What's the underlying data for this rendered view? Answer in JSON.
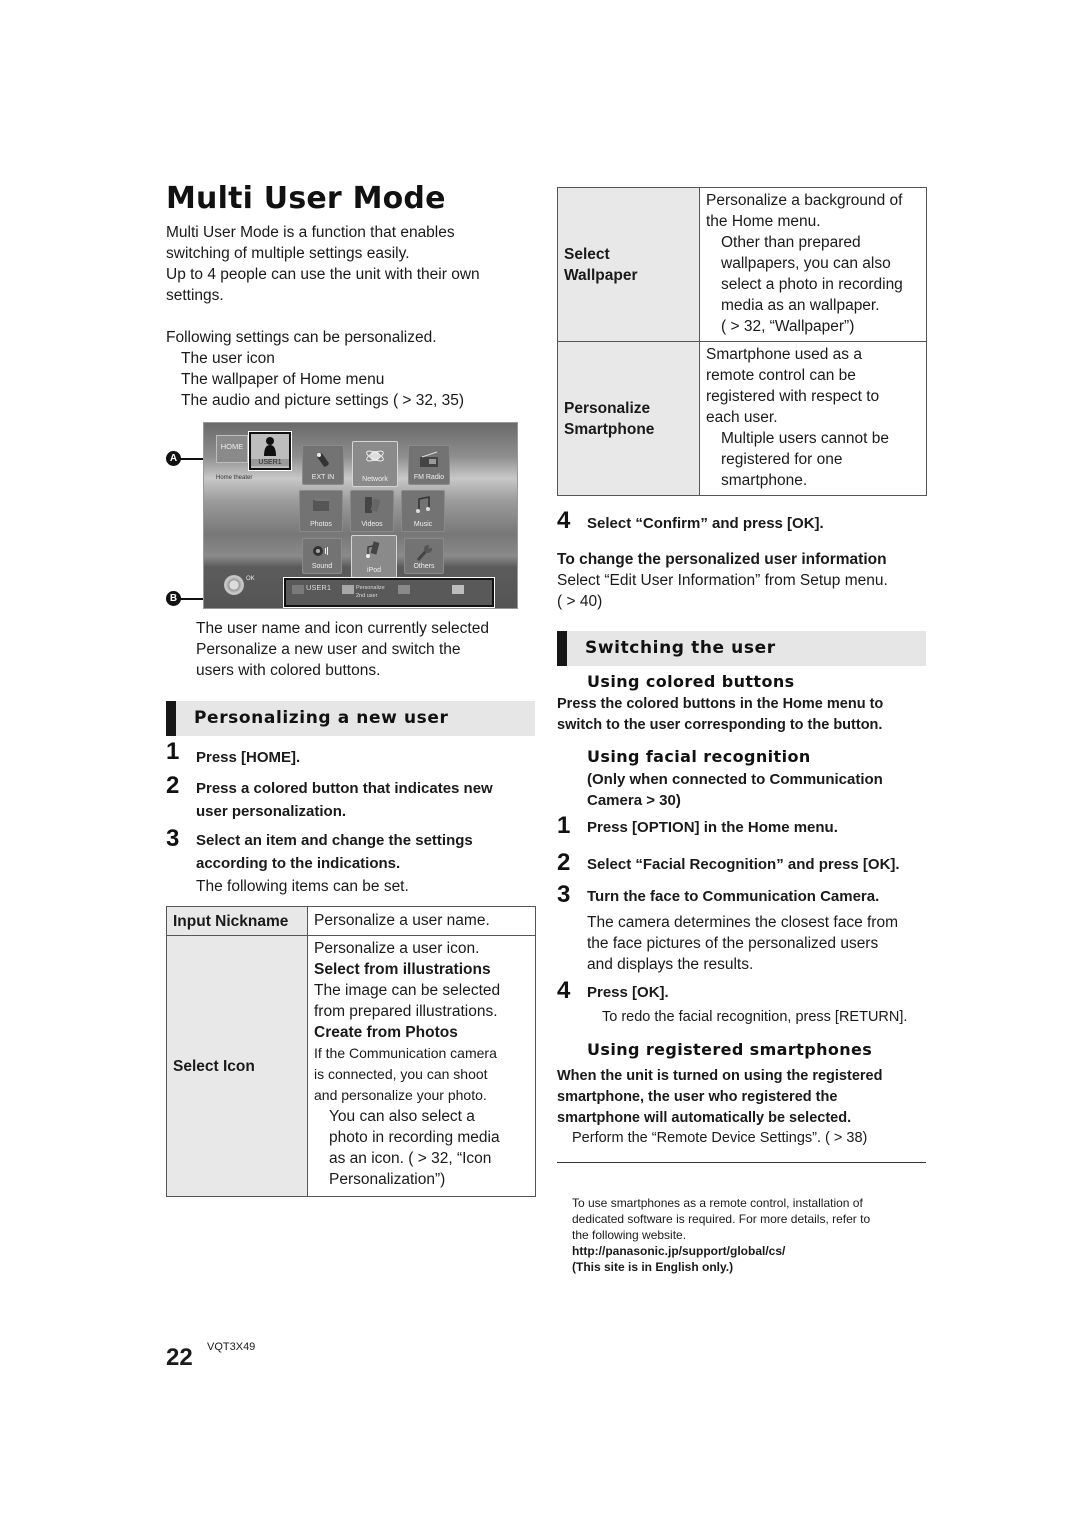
{
  "page": {
    "title": "Multi User Mode",
    "page_number": "22",
    "doc_code": "VQT3X49"
  },
  "intro": {
    "p1_line1": "Multi User Mode is a function that enables",
    "p1_line2": "switching of multiple settings easily.",
    "p2_line1": "Up to 4 people can use the unit with their own",
    "p2_line2": "settings.",
    "list_lead": "Following settings can be personalized.",
    "list_items": [
      "The user icon",
      "The wallpaper of Home menu",
      "The audio and picture settings ( > 32, 35)"
    ]
  },
  "screenshot": {
    "home_label": "HOME",
    "user_label": "USER1",
    "device_label": "Home theater",
    "tiles": [
      {
        "label": "EXT IN",
        "icon": "plug-icon"
      },
      {
        "label": "Network",
        "icon": "globe-icon"
      },
      {
        "label": "FM Radio",
        "icon": "radio-icon"
      },
      {
        "label": "Photos",
        "icon": "photos-icon"
      },
      {
        "label": "Videos",
        "icon": "film-icon"
      },
      {
        "label": "Music",
        "icon": "music-note-icon"
      },
      {
        "label": "Sound",
        "icon": "speaker-icon"
      },
      {
        "label": "iPod",
        "icon": "ipod-icon"
      },
      {
        "label": "Others",
        "icon": "wrench-icon"
      }
    ],
    "ok_label": "OK",
    "bottom_bar": {
      "user": "USER1",
      "personalize_line1": "Personalize",
      "personalize_line2": "2nd user"
    },
    "callouts": [
      "A",
      "B"
    ]
  },
  "callout_desc": {
    "a": "The user name and icon currently selected",
    "b_line1": "Personalize a new user and switch the",
    "b_line2": "users with colored buttons."
  },
  "personalizing": {
    "heading": "Personalizing a new user",
    "steps": [
      {
        "num": "1",
        "line1": "Press [HOME].",
        "line2": ""
      },
      {
        "num": "2",
        "line1": "Press a colored button that indicates new",
        "line2": "user personalization."
      },
      {
        "num": "3",
        "line1": "Select an item and change the settings",
        "line2": "according to the indications."
      }
    ],
    "step3_note": "The following items can be set.",
    "table": [
      {
        "head": "Input Nickname",
        "body": [
          "Personalize a user name."
        ]
      },
      {
        "head": "Select Icon",
        "body": [
          "Personalize a user icon.",
          "Select from illustrations",
          "The image can be selected",
          "from prepared illustrations.",
          "Create from Photos",
          "If the Communication camera",
          "is connected, you can shoot",
          "and personalize your photo.",
          "You can also select a",
          "photo in recording media",
          "as an icon. ( > 32, “Icon",
          "Personalization”)"
        ]
      }
    ]
  },
  "right_table": [
    {
      "head_line1": "Select",
      "head_line2": "Wallpaper",
      "body": [
        "Personalize a background of",
        "the Home menu.",
        "Other than prepared",
        "wallpapers, you can also",
        "select a photo in recording",
        "media as an wallpaper.",
        "( > 32, “Wallpaper”)"
      ]
    },
    {
      "head_line1": "Personalize",
      "head_line2": "Smartphone",
      "body": [
        "Smartphone used as a",
        "remote control can be",
        "registered with respect to",
        "each user.",
        "Multiple users cannot be",
        "registered for one",
        "smartphone."
      ]
    }
  ],
  "step4": {
    "num": "4",
    "text": "Select “Confirm” and press [OK]."
  },
  "change_info": {
    "heading": "To change the personalized user information",
    "line1": "Select “Edit User Information” from Setup menu.",
    "line2": "( > 40)"
  },
  "switching": {
    "heading": "Switching the user",
    "colored": {
      "heading": "Using colored buttons",
      "line1": "Press the colored buttons in the Home menu to",
      "line2": "switch to the user corresponding to the button."
    },
    "facial": {
      "heading": "Using facial recognition",
      "note_line1": "(Only when connected to Communication",
      "note_line2": "Camera  > 30)",
      "steps": [
        {
          "num": "1",
          "text": "Press [OPTION] in the Home menu."
        },
        {
          "num": "2",
          "text": "Select “Facial Recognition” and press [OK]."
        },
        {
          "num": "3",
          "text": "Turn the face to Communication Camera."
        },
        {
          "num": "4",
          "text": "Press [OK]."
        }
      ],
      "step3_desc": [
        "The camera determines the closest face from",
        "the face pictures of the personalized users",
        "and displays the results."
      ],
      "step4_note": "To redo the facial recognition, press [RETURN]."
    },
    "smartphones": {
      "heading": "Using registered smartphones",
      "lines": [
        "When the unit is turned on using the registered",
        "smartphone, the user who registered the",
        "smartphone will automatically be selected."
      ],
      "note": "Perform the “Remote Device Settings”. ( > 38)"
    }
  },
  "footnote": {
    "lines": [
      "To use smartphones as a remote control, installation of",
      "dedicated software is required. For more details, refer to",
      "the following website."
    ],
    "url": "http://panasonic.jp/support/global/cs/",
    "english_only": "(This site is in English only.)"
  }
}
